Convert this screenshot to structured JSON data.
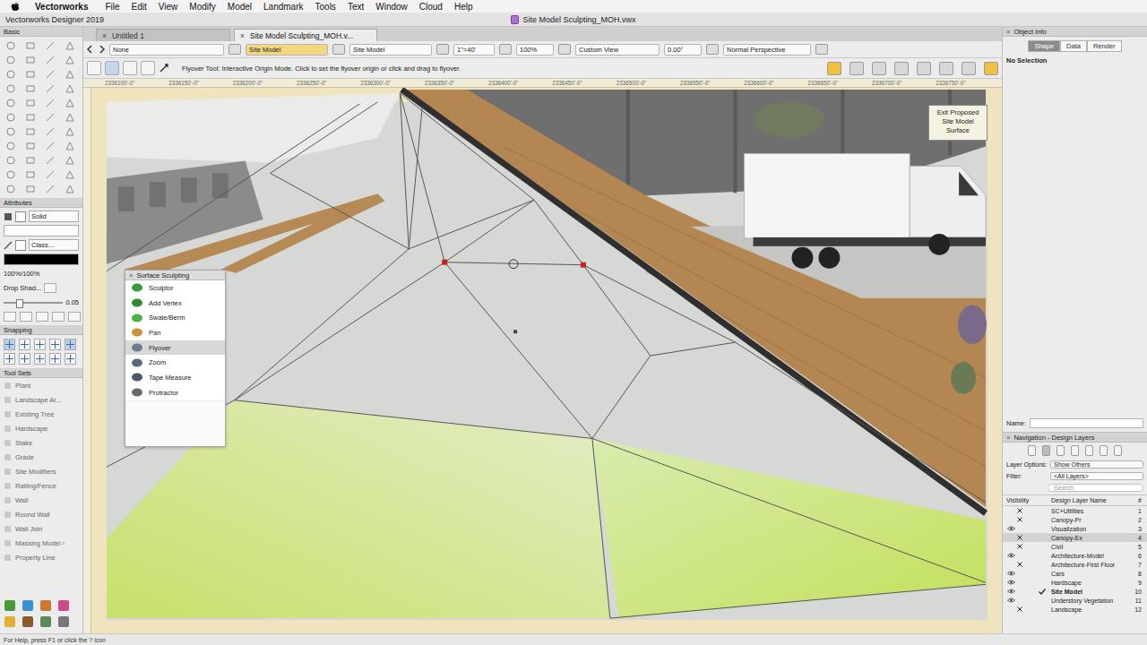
{
  "menubar": {
    "app": "Vectorworks",
    "items": [
      "File",
      "Edit",
      "View",
      "Modify",
      "Model",
      "Landmark",
      "Tools",
      "Text",
      "Window",
      "Cloud",
      "Help"
    ]
  },
  "window": {
    "app_title": "Vectorworks Designer 2019",
    "title": "Site Model Sculpting_MOH.vwx"
  },
  "basic_palette": {
    "title": "Basic"
  },
  "attributes": {
    "title": "Attributes",
    "fill": "Solid",
    "pen": "Class...",
    "opacity": "100%/100%",
    "drop_shadow": "Drop Shad...",
    "line_weight": "0.05"
  },
  "snapping": {
    "title": "Snapping"
  },
  "tool_sets": {
    "title": "Tool Sets",
    "items": [
      "Plant",
      "Landscape Ar...",
      "Existing Tree",
      "Hardscape",
      "Stake",
      "Grade",
      "Site Modifiers",
      "Railing/Fence",
      "Wall",
      "Round Wall",
      "Wall Join",
      "Massing Model ›",
      "Property Line"
    ]
  },
  "doc_tabs": [
    {
      "label": "Untitled 1",
      "selected": false,
      "close": "×"
    },
    {
      "label": "Site Model Sculpting_MOH.v...",
      "selected": true,
      "close": "×"
    }
  ],
  "view_bar": {
    "class": "None",
    "layer": "Site Model",
    "layer2": "Site Model",
    "scale": "1\"=40'",
    "zoom": "100%",
    "view": "Custom View",
    "rotation": "0.00°",
    "render": "Normal Perspective"
  },
  "tool_bar": {
    "hint": "Flyover Tool: Interactive Origin Mode. Click to set the flyover origin or click and drag to flyover."
  },
  "ruler_ticks": [
    "2336100'-0\"",
    "2336150'-0\"",
    "2336200'-0\"",
    "2336250'-0\"",
    "2336300'-0\"",
    "2336350'-0\"",
    "2336400'-0\"",
    "2336450'-0\"",
    "2336500'-0\"",
    "2336550'-0\"",
    "2336600'-0\"",
    "2336650'-0\"",
    "2336700'-0\"",
    "2336750'-0\""
  ],
  "exit_button": "Exit Proposed Site Model Surface",
  "surface_palette": {
    "title": "Surface Sculpting",
    "close": "×",
    "items": [
      {
        "label": "Sculptor",
        "selected": false
      },
      {
        "label": "Add Vertex",
        "selected": false
      },
      {
        "label": "Swale/Berm",
        "selected": false
      },
      {
        "label": "Pan",
        "selected": false
      },
      {
        "label": "Flyover",
        "selected": true
      },
      {
        "label": "Zoom",
        "selected": false
      },
      {
        "label": "Tape Measure",
        "selected": false
      },
      {
        "label": "Protractor",
        "selected": false
      }
    ]
  },
  "object_info": {
    "title": "Object Info",
    "close": "×",
    "tabs": [
      {
        "label": "Shape",
        "selected": true
      },
      {
        "label": "Data",
        "selected": false
      },
      {
        "label": "Render",
        "selected": false
      }
    ],
    "selection": "No Selection",
    "name_label": "Name:"
  },
  "navigation": {
    "title": "Navigation - Design Layers",
    "close": "×",
    "layer_options_label": "Layer Options:",
    "layer_options": "Show Others",
    "filter_label": "Filter:",
    "filter": "<All Layers>",
    "search_placeholder": "Search",
    "columns": [
      "Visibility",
      "Design Layer Name",
      "#"
    ],
    "layers": [
      {
        "name": "SC+Utilities",
        "number": "1",
        "visible": false,
        "selected": false,
        "active": false
      },
      {
        "name": "Canopy-Pr",
        "number": "2",
        "visible": false,
        "selected": false,
        "active": false
      },
      {
        "name": "Visualization",
        "number": "3",
        "visible": true,
        "selected": false,
        "active": false
      },
      {
        "name": "Canopy-Ex",
        "number": "4",
        "visible": false,
        "selected": true,
        "active": false
      },
      {
        "name": "Civil",
        "number": "5",
        "visible": false,
        "selected": false,
        "active": false
      },
      {
        "name": "Architecture-Model",
        "number": "6",
        "visible": true,
        "selected": false,
        "active": false
      },
      {
        "name": "Architecture-First Floor",
        "number": "7",
        "visible": false,
        "selected": false,
        "active": false
      },
      {
        "name": "Cars",
        "number": "8",
        "visible": true,
        "selected": false,
        "active": false
      },
      {
        "name": "Hardscape",
        "number": "9",
        "visible": true,
        "selected": false,
        "active": false
      },
      {
        "name": "Site Model",
        "number": "10",
        "visible": true,
        "selected": false,
        "active": true
      },
      {
        "name": "Understory Vegetation",
        "number": "11",
        "visible": true,
        "selected": false,
        "active": false
      },
      {
        "name": "Landscape",
        "number": "12",
        "visible": false,
        "selected": false,
        "active": false
      }
    ]
  },
  "status_bar": "For Help, press F1 or click the ? icon"
}
